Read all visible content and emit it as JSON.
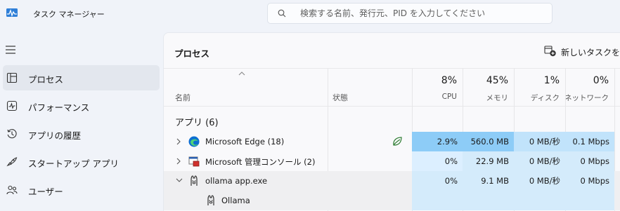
{
  "app": {
    "title": "タスク マネージャー",
    "icon": "task-manager-icon"
  },
  "search": {
    "placeholder": "検索する名前、発行元、PID を入力してください"
  },
  "sidebar": {
    "items": [
      {
        "label": "プロセス",
        "icon": "processes-icon",
        "selected": true
      },
      {
        "label": "パフォーマンス",
        "icon": "performance-icon"
      },
      {
        "label": "アプリの履歴",
        "icon": "app-history-icon"
      },
      {
        "label": "スタートアップ アプリ",
        "icon": "startup-apps-icon"
      },
      {
        "label": "ユーザー",
        "icon": "users-icon"
      }
    ]
  },
  "main": {
    "title": "プロセス",
    "new_task_label": "新しいタスクを実行",
    "columns": {
      "name": "名前",
      "status": "状態",
      "cpu": {
        "pct": "8%",
        "label": "CPU"
      },
      "memory": {
        "pct": "45%",
        "label": "メモリ"
      },
      "disk": {
        "pct": "1%",
        "label": "ディスク"
      },
      "network": {
        "pct": "0%",
        "label": "ネットワーク"
      }
    },
    "group_title": "アプリ (6)",
    "rows": [
      {
        "name": "Microsoft Edge (18)",
        "icon": "edge-icon",
        "expand": "chevron-right",
        "status_icon": "efficiency-leaf-icon",
        "cpu": "2.9%",
        "memory": "560.0 MB",
        "disk": "0 MB/秒",
        "network": "0.1 Mbps"
      },
      {
        "name": "Microsoft 管理コンソール (2)",
        "icon": "mmc-icon",
        "expand": "chevron-right",
        "cpu": "0%",
        "memory": "22.9 MB",
        "disk": "0 MB/秒",
        "network": "0 Mbps"
      },
      {
        "name": "ollama app.exe",
        "icon": "ollama-icon",
        "expand": "chevron-down",
        "cpu": "0%",
        "memory": "9.1 MB",
        "disk": "0 MB/秒",
        "network": "0 Mbps"
      },
      {
        "name": "Ollama",
        "icon": "ollama-icon",
        "child": true
      }
    ]
  },
  "colors": {
    "heat_high": "#8dccf7",
    "heat_mid": "#c1e3fb",
    "heat_low": "#dcefff",
    "heat_sub": "#d4ebfb",
    "accent": "#0067c0"
  }
}
